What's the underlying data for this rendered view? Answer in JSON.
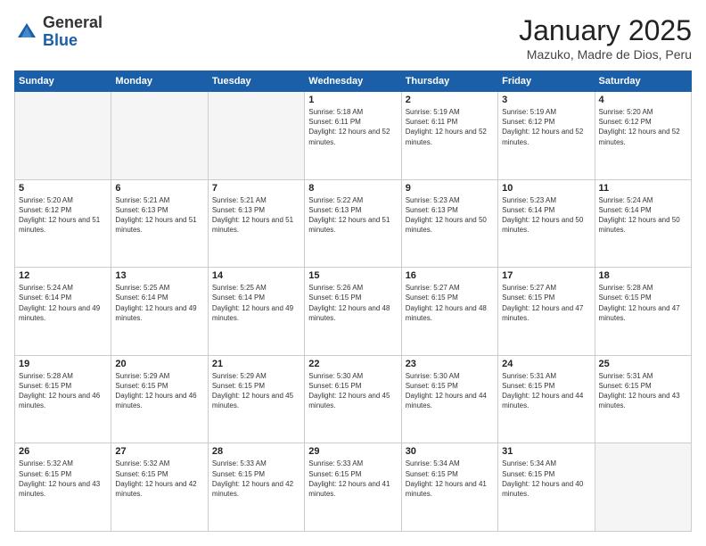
{
  "logo": {
    "general": "General",
    "blue": "Blue"
  },
  "header": {
    "title": "January 2025",
    "subtitle": "Mazuko, Madre de Dios, Peru"
  },
  "days_of_week": [
    "Sunday",
    "Monday",
    "Tuesday",
    "Wednesday",
    "Thursday",
    "Friday",
    "Saturday"
  ],
  "weeks": [
    [
      {
        "day": "",
        "sunrise": "",
        "sunset": "",
        "daylight": "",
        "empty": true
      },
      {
        "day": "",
        "sunrise": "",
        "sunset": "",
        "daylight": "",
        "empty": true
      },
      {
        "day": "",
        "sunrise": "",
        "sunset": "",
        "daylight": "",
        "empty": true
      },
      {
        "day": "1",
        "sunrise": "Sunrise: 5:18 AM",
        "sunset": "Sunset: 6:11 PM",
        "daylight": "Daylight: 12 hours and 52 minutes.",
        "empty": false
      },
      {
        "day": "2",
        "sunrise": "Sunrise: 5:19 AM",
        "sunset": "Sunset: 6:11 PM",
        "daylight": "Daylight: 12 hours and 52 minutes.",
        "empty": false
      },
      {
        "day": "3",
        "sunrise": "Sunrise: 5:19 AM",
        "sunset": "Sunset: 6:12 PM",
        "daylight": "Daylight: 12 hours and 52 minutes.",
        "empty": false
      },
      {
        "day": "4",
        "sunrise": "Sunrise: 5:20 AM",
        "sunset": "Sunset: 6:12 PM",
        "daylight": "Daylight: 12 hours and 52 minutes.",
        "empty": false
      }
    ],
    [
      {
        "day": "5",
        "sunrise": "Sunrise: 5:20 AM",
        "sunset": "Sunset: 6:12 PM",
        "daylight": "Daylight: 12 hours and 51 minutes.",
        "empty": false
      },
      {
        "day": "6",
        "sunrise": "Sunrise: 5:21 AM",
        "sunset": "Sunset: 6:13 PM",
        "daylight": "Daylight: 12 hours and 51 minutes.",
        "empty": false
      },
      {
        "day": "7",
        "sunrise": "Sunrise: 5:21 AM",
        "sunset": "Sunset: 6:13 PM",
        "daylight": "Daylight: 12 hours and 51 minutes.",
        "empty": false
      },
      {
        "day": "8",
        "sunrise": "Sunrise: 5:22 AM",
        "sunset": "Sunset: 6:13 PM",
        "daylight": "Daylight: 12 hours and 51 minutes.",
        "empty": false
      },
      {
        "day": "9",
        "sunrise": "Sunrise: 5:23 AM",
        "sunset": "Sunset: 6:13 PM",
        "daylight": "Daylight: 12 hours and 50 minutes.",
        "empty": false
      },
      {
        "day": "10",
        "sunrise": "Sunrise: 5:23 AM",
        "sunset": "Sunset: 6:14 PM",
        "daylight": "Daylight: 12 hours and 50 minutes.",
        "empty": false
      },
      {
        "day": "11",
        "sunrise": "Sunrise: 5:24 AM",
        "sunset": "Sunset: 6:14 PM",
        "daylight": "Daylight: 12 hours and 50 minutes.",
        "empty": false
      }
    ],
    [
      {
        "day": "12",
        "sunrise": "Sunrise: 5:24 AM",
        "sunset": "Sunset: 6:14 PM",
        "daylight": "Daylight: 12 hours and 49 minutes.",
        "empty": false
      },
      {
        "day": "13",
        "sunrise": "Sunrise: 5:25 AM",
        "sunset": "Sunset: 6:14 PM",
        "daylight": "Daylight: 12 hours and 49 minutes.",
        "empty": false
      },
      {
        "day": "14",
        "sunrise": "Sunrise: 5:25 AM",
        "sunset": "Sunset: 6:14 PM",
        "daylight": "Daylight: 12 hours and 49 minutes.",
        "empty": false
      },
      {
        "day": "15",
        "sunrise": "Sunrise: 5:26 AM",
        "sunset": "Sunset: 6:15 PM",
        "daylight": "Daylight: 12 hours and 48 minutes.",
        "empty": false
      },
      {
        "day": "16",
        "sunrise": "Sunrise: 5:27 AM",
        "sunset": "Sunset: 6:15 PM",
        "daylight": "Daylight: 12 hours and 48 minutes.",
        "empty": false
      },
      {
        "day": "17",
        "sunrise": "Sunrise: 5:27 AM",
        "sunset": "Sunset: 6:15 PM",
        "daylight": "Daylight: 12 hours and 47 minutes.",
        "empty": false
      },
      {
        "day": "18",
        "sunrise": "Sunrise: 5:28 AM",
        "sunset": "Sunset: 6:15 PM",
        "daylight": "Daylight: 12 hours and 47 minutes.",
        "empty": false
      }
    ],
    [
      {
        "day": "19",
        "sunrise": "Sunrise: 5:28 AM",
        "sunset": "Sunset: 6:15 PM",
        "daylight": "Daylight: 12 hours and 46 minutes.",
        "empty": false
      },
      {
        "day": "20",
        "sunrise": "Sunrise: 5:29 AM",
        "sunset": "Sunset: 6:15 PM",
        "daylight": "Daylight: 12 hours and 46 minutes.",
        "empty": false
      },
      {
        "day": "21",
        "sunrise": "Sunrise: 5:29 AM",
        "sunset": "Sunset: 6:15 PM",
        "daylight": "Daylight: 12 hours and 45 minutes.",
        "empty": false
      },
      {
        "day": "22",
        "sunrise": "Sunrise: 5:30 AM",
        "sunset": "Sunset: 6:15 PM",
        "daylight": "Daylight: 12 hours and 45 minutes.",
        "empty": false
      },
      {
        "day": "23",
        "sunrise": "Sunrise: 5:30 AM",
        "sunset": "Sunset: 6:15 PM",
        "daylight": "Daylight: 12 hours and 44 minutes.",
        "empty": false
      },
      {
        "day": "24",
        "sunrise": "Sunrise: 5:31 AM",
        "sunset": "Sunset: 6:15 PM",
        "daylight": "Daylight: 12 hours and 44 minutes.",
        "empty": false
      },
      {
        "day": "25",
        "sunrise": "Sunrise: 5:31 AM",
        "sunset": "Sunset: 6:15 PM",
        "daylight": "Daylight: 12 hours and 43 minutes.",
        "empty": false
      }
    ],
    [
      {
        "day": "26",
        "sunrise": "Sunrise: 5:32 AM",
        "sunset": "Sunset: 6:15 PM",
        "daylight": "Daylight: 12 hours and 43 minutes.",
        "empty": false
      },
      {
        "day": "27",
        "sunrise": "Sunrise: 5:32 AM",
        "sunset": "Sunset: 6:15 PM",
        "daylight": "Daylight: 12 hours and 42 minutes.",
        "empty": false
      },
      {
        "day": "28",
        "sunrise": "Sunrise: 5:33 AM",
        "sunset": "Sunset: 6:15 PM",
        "daylight": "Daylight: 12 hours and 42 minutes.",
        "empty": false
      },
      {
        "day": "29",
        "sunrise": "Sunrise: 5:33 AM",
        "sunset": "Sunset: 6:15 PM",
        "daylight": "Daylight: 12 hours and 41 minutes.",
        "empty": false
      },
      {
        "day": "30",
        "sunrise": "Sunrise: 5:34 AM",
        "sunset": "Sunset: 6:15 PM",
        "daylight": "Daylight: 12 hours and 41 minutes.",
        "empty": false
      },
      {
        "day": "31",
        "sunrise": "Sunrise: 5:34 AM",
        "sunset": "Sunset: 6:15 PM",
        "daylight": "Daylight: 12 hours and 40 minutes.",
        "empty": false
      },
      {
        "day": "",
        "sunrise": "",
        "sunset": "",
        "daylight": "",
        "empty": true
      }
    ]
  ]
}
